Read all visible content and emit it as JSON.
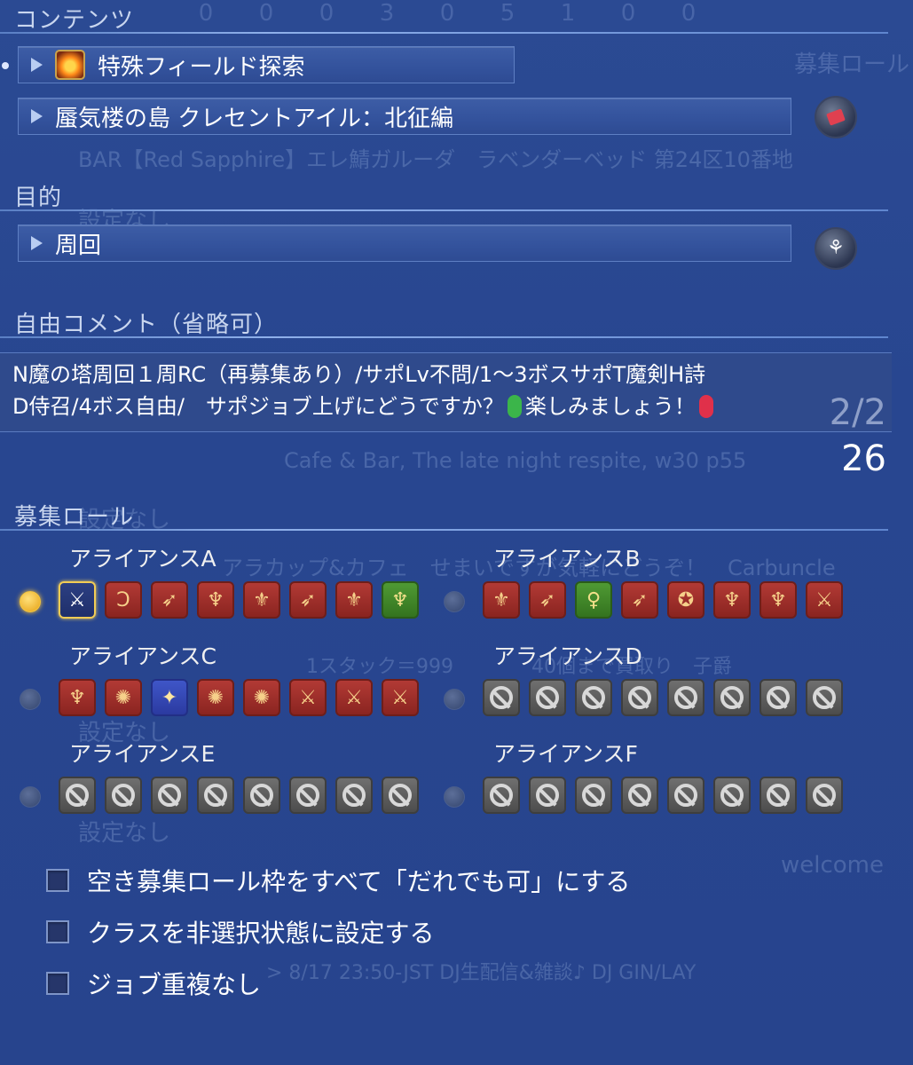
{
  "background_ghost": {
    "numbers": [
      "0",
      "0",
      "0",
      "3",
      "0",
      "5",
      "1",
      "0",
      "0"
    ],
    "lines": [
      "募集ロール",
      "BAR【Red Sapphire】エレ鯖ガルーダ　ラベンダーベッド 第24区10番地",
      "設定なし",
      "Cafe & Bar, The late night respite, w30 p55",
      "設定なし",
      "アラカップ&カフェ　せまいですが気軽にどうぞ！　Carbuncle",
      "1スタック＝999　　　　40個まで買取り　子爵",
      "設定なし",
      "設定なし",
      "welcome",
      "> 8/17 23:50-JST DJ生配信&雑談♪ DJ GIN/LAY"
    ]
  },
  "contents": {
    "title": "コンテンツ",
    "category": "特殊フィールド探索",
    "duty": "蜃気楼の島 クレセントアイル：北征編"
  },
  "purpose": {
    "title": "目的",
    "value": "周回"
  },
  "comment": {
    "title": "自由コメント（省略可）",
    "line1": "N魔の塔周回１周RC（再募集あり）/サポLv不問/1～3ボスサポT魔剣H詩",
    "line2_a": "D侍召/4ボス自由/　サポジョブ上げにどうですか？",
    "line2_b": "楽しみましょう！",
    "page": "2/2",
    "count": "26"
  },
  "roles": {
    "title": "募集ロール",
    "alliances": [
      {
        "label": "アライアンスA",
        "slots": [
          "sel:⚔",
          "dps:Ↄ",
          "dps:➶",
          "dps:♆",
          "dps:⚜",
          "dps:➶",
          "dps:⚜",
          "healer:♆"
        ]
      },
      {
        "label": "アライアンスB",
        "slots": [
          "dps:⚜",
          "dps:➶",
          "healer:♀",
          "dps:➶",
          "dps:✪",
          "dps:♆",
          "dps:♆",
          "dps:⚔"
        ]
      },
      {
        "label": "アライアンスC",
        "slots": [
          "dps:♆",
          "dps:✺",
          "tank:✦",
          "dps:✺",
          "dps:✺",
          "dps:⚔",
          "dps:⚔",
          "dps:⚔"
        ]
      },
      {
        "label": "アライアンスD",
        "slots": [
          "none",
          "none",
          "none",
          "none",
          "none",
          "none",
          "none",
          "none"
        ]
      },
      {
        "label": "アライアンスE",
        "slots": [
          "none",
          "none",
          "none",
          "none",
          "none",
          "none",
          "none",
          "none"
        ]
      },
      {
        "label": "アライアンスF",
        "slots": [
          "none",
          "none",
          "none",
          "none",
          "none",
          "none",
          "none",
          "none"
        ]
      }
    ]
  },
  "options": [
    {
      "label": "空き募集ロール枠をすべて「だれでも可」にする",
      "checked": false
    },
    {
      "label": "クラスを非選択状態に設定する",
      "checked": false
    },
    {
      "label": "ジョブ重複なし",
      "checked": false
    }
  ]
}
